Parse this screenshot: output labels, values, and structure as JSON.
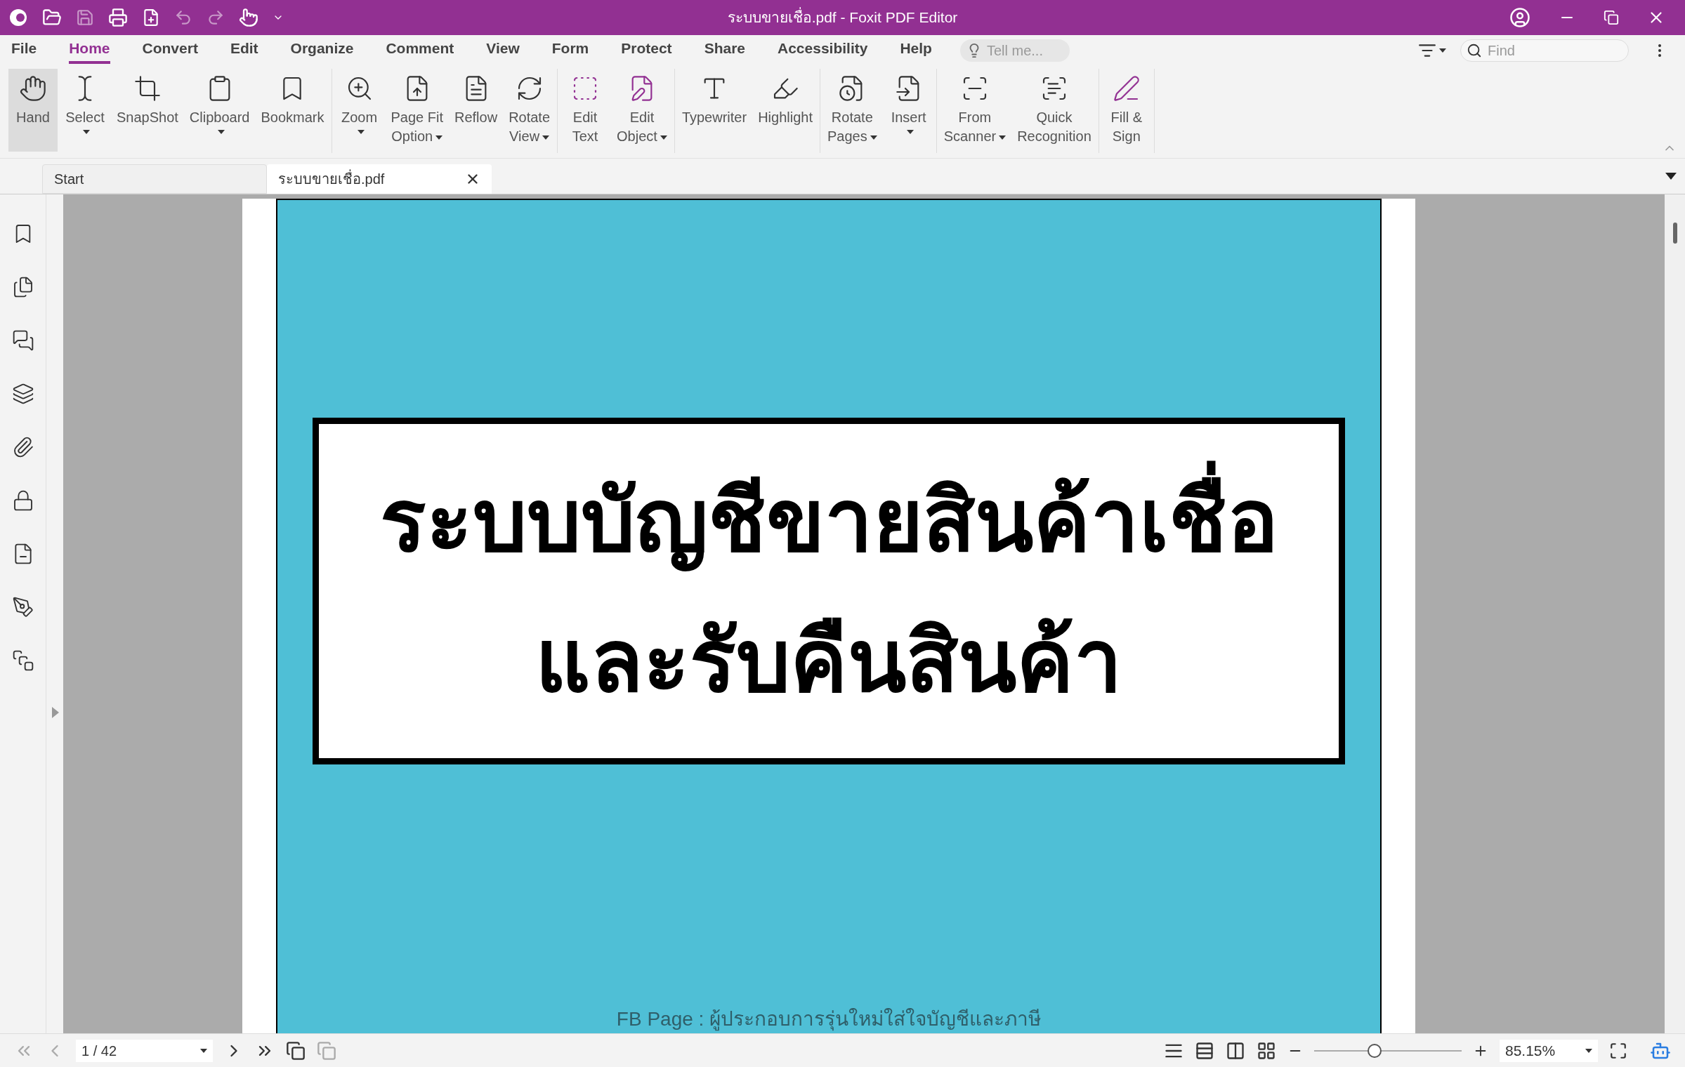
{
  "window": {
    "title": "ระบบขายเชื่อ.pdf - Foxit PDF Editor"
  },
  "menu_tabs": [
    {
      "label": "File",
      "selected": false
    },
    {
      "label": "Home",
      "selected": true
    },
    {
      "label": "Convert",
      "selected": false
    },
    {
      "label": "Edit",
      "selected": false
    },
    {
      "label": "Organize",
      "selected": false
    },
    {
      "label": "Comment",
      "selected": false
    },
    {
      "label": "View",
      "selected": false
    },
    {
      "label": "Form",
      "selected": false
    },
    {
      "label": "Protect",
      "selected": false
    },
    {
      "label": "Share",
      "selected": false
    },
    {
      "label": "Accessibility",
      "selected": false
    },
    {
      "label": "Help",
      "selected": false
    }
  ],
  "tell_me": {
    "placeholder": "Tell me..."
  },
  "find": {
    "placeholder": "Find"
  },
  "ribbon_groups": [
    [
      {
        "kind": "hand",
        "label": [
          "Hand"
        ],
        "dropdown": false,
        "selected": true
      },
      {
        "kind": "select",
        "label": [
          "Select"
        ],
        "dropdown": true,
        "selected": false
      },
      {
        "kind": "snapshot",
        "label": [
          "SnapShot"
        ],
        "dropdown": false,
        "selected": false
      },
      {
        "kind": "clipboard",
        "label": [
          "Clipboard"
        ],
        "dropdown": true,
        "selected": false
      },
      {
        "kind": "bookmark",
        "label": [
          "Bookmark"
        ],
        "dropdown": false,
        "selected": false
      }
    ],
    [
      {
        "kind": "zoom",
        "label": [
          "Zoom"
        ],
        "dropdown": true,
        "selected": false
      },
      {
        "kind": "pagefit",
        "label": [
          "Page Fit",
          "Option"
        ],
        "dropdown": true,
        "selected": false
      },
      {
        "kind": "reflow",
        "label": [
          "Reflow"
        ],
        "dropdown": false,
        "selected": false
      },
      {
        "kind": "rotate",
        "label": [
          "Rotate",
          "View"
        ],
        "dropdown": true,
        "selected": false
      }
    ],
    [
      {
        "kind": "edittext",
        "label": [
          "Edit",
          "Text"
        ],
        "dropdown": false,
        "selected": false
      },
      {
        "kind": "editobject",
        "label": [
          "Edit",
          "Object"
        ],
        "dropdown": true,
        "selected": false
      }
    ],
    [
      {
        "kind": "typewriter",
        "label": [
          "Typewriter"
        ],
        "dropdown": false,
        "selected": false
      },
      {
        "kind": "highlight",
        "label": [
          "Highlight"
        ],
        "dropdown": false,
        "selected": false
      }
    ],
    [
      {
        "kind": "rotatepages",
        "label": [
          "Rotate",
          "Pages"
        ],
        "dropdown": true,
        "selected": false
      },
      {
        "kind": "insert",
        "label": [
          "Insert"
        ],
        "dropdown": true,
        "selected": false
      }
    ],
    [
      {
        "kind": "scanner",
        "label": [
          "From",
          "Scanner"
        ],
        "dropdown": true,
        "selected": false
      },
      {
        "kind": "ocr",
        "label": [
          "Quick",
          "Recognition"
        ],
        "dropdown": false,
        "selected": false
      }
    ],
    [
      {
        "kind": "fillsign",
        "label": [
          "Fill &",
          "Sign"
        ],
        "dropdown": false,
        "selected": false
      }
    ]
  ],
  "doc_tabs": [
    {
      "label": "Start",
      "selected": false
    },
    {
      "label": "ระบบขายเชื่อ.pdf",
      "selected": true
    }
  ],
  "page": {
    "title_lines": [
      "ระบบบัญชีขายสินค้าเชื่อ",
      "และรับคืนสินค้า"
    ],
    "footer": "FB Page : ผู้ประกอบการรุ่นใหม่ใส่ใจบัญชีและภาษี"
  },
  "status_bar": {
    "page_field": "1 / 42",
    "zoom": {
      "level": 0.41,
      "reading": "85.15%"
    }
  }
}
